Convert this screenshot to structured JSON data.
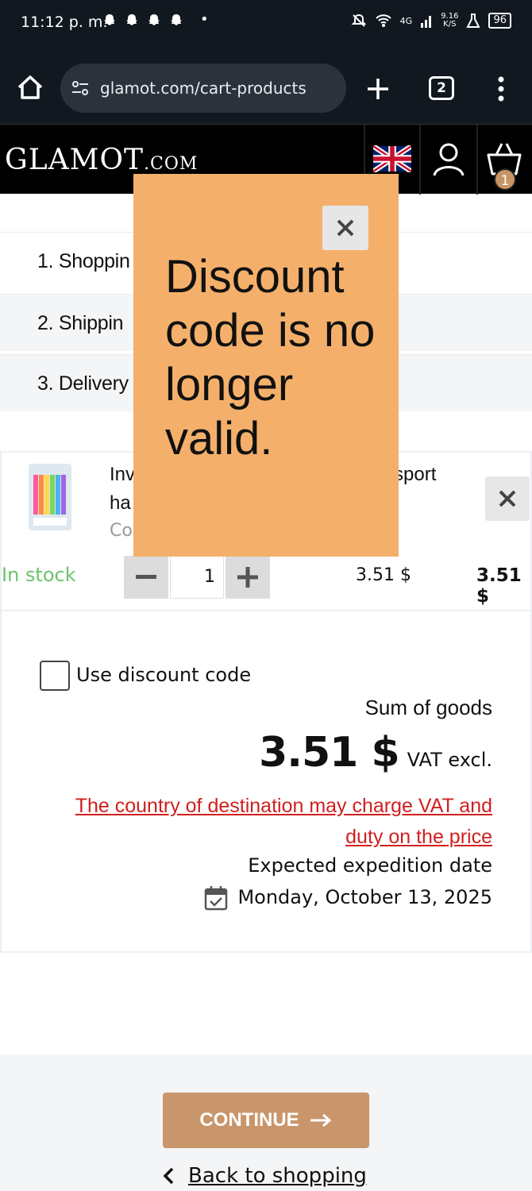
{
  "status_bar": {
    "time": "11:12 p. m.",
    "notification_icons": [
      "snapchat-icon",
      "snapchat-icon",
      "snapchat-icon",
      "snapchat-icon"
    ],
    "dot": "•",
    "network": "4G",
    "speed_top": "9.16",
    "speed_bottom": "K/S",
    "battery": "96"
  },
  "browser": {
    "url": "glamot.com/cart-products",
    "tab_count": "2"
  },
  "site_header": {
    "logo_main": "GLAMOT",
    "logo_suffix": ".COM",
    "cart_count": "1"
  },
  "steps": [
    {
      "label": "1. Shoppin"
    },
    {
      "label": "2. Shippin"
    },
    {
      "label": "3. Delivery"
    }
  ],
  "product": {
    "name_line1": "Inv",
    "name_tail": "sport",
    "name_line2": "ha",
    "code_prefix": "Co",
    "stock": "In stock",
    "quantity": "1",
    "unit_price": "3.51 $",
    "line_total": "3.51 $"
  },
  "summary": {
    "discount_label": "Use discount code",
    "sum_label": "Sum of goods",
    "sum_value": "3.51 $",
    "vat_label": "VAT excl.",
    "vat_note": "The country of destination may charge VAT and duty on the price",
    "expedition_label": "Expected expedition date",
    "expedition_date": "Monday, October 13, 2025"
  },
  "actions": {
    "continue_label": "CONTINUE",
    "back_label": "Back to shopping"
  },
  "popup": {
    "message": "Discount code is no longer valid."
  },
  "colors": {
    "accent": "#c8966a",
    "popup_bg": "#f4b06b",
    "in_stock": "#6cc46b",
    "warning": "#d11f1f",
    "header_bg": "#000000",
    "browser_bg": "#121820"
  }
}
